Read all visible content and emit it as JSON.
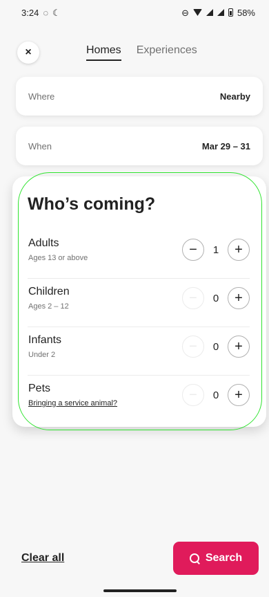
{
  "status_bar": {
    "time": "3:24",
    "battery": "58%"
  },
  "nav": {
    "close_symbol": "×",
    "tabs": [
      {
        "label": "Homes",
        "active": true
      },
      {
        "label": "Experiences",
        "active": false
      }
    ]
  },
  "where": {
    "label": "Where",
    "value": "Nearby"
  },
  "when": {
    "label": "When",
    "value": "Mar 29 – 31"
  },
  "who": {
    "title": "Who’s coming?",
    "rows": [
      {
        "name": "Adults",
        "sub": "Ages 13 or above",
        "count": "1",
        "minus_enabled": true
      },
      {
        "name": "Children",
        "sub": "Ages 2 – 12",
        "count": "0",
        "minus_enabled": false
      },
      {
        "name": "Infants",
        "sub": "Under 2",
        "count": "0",
        "minus_enabled": false
      },
      {
        "name": "Pets",
        "sub": "Bringing a service animal?",
        "count": "0",
        "minus_enabled": false
      }
    ],
    "minus_symbol": "−",
    "plus_symbol": "+"
  },
  "footer": {
    "clear_label": "Clear all",
    "search_label": "Search"
  },
  "colors": {
    "accent": "#e01b5b",
    "highlight_outline": "#2ee32e"
  }
}
